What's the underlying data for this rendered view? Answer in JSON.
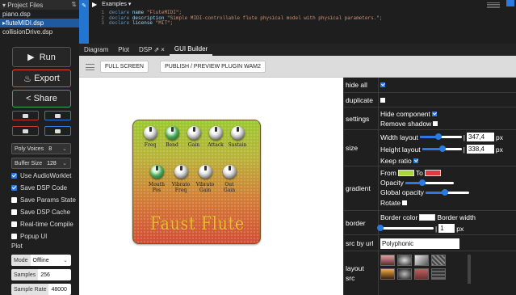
{
  "files": {
    "header": "Project Files",
    "items": [
      "piano.dsp",
      "fluteMIDI.dsp",
      "collisionDrive.dsp"
    ],
    "active": 1
  },
  "left": {
    "run": "Run",
    "export": "Export",
    "share": "Share",
    "poly": {
      "label": "Poly Voices",
      "value": "8"
    },
    "buffer": {
      "label": "Buffer Size",
      "value": "128"
    },
    "options": [
      {
        "label": "Use AudioWorklet",
        "checked": true
      },
      {
        "label": "Save DSP Code",
        "checked": true
      },
      {
        "label": "Save Params State",
        "checked": false
      },
      {
        "label": "Save DSP Cache",
        "checked": false
      },
      {
        "label": "Real-time Compile",
        "checked": false
      },
      {
        "label": "Popup UI",
        "checked": false
      }
    ],
    "plot_label": "Plot",
    "mode": {
      "label": "Mode",
      "value": "Offline"
    },
    "samples": {
      "label": "Samples",
      "value": "256"
    },
    "sample_rate": {
      "label": "Sample Rate",
      "value": "48000"
    }
  },
  "editor": {
    "examples": "Examples",
    "lines": [
      {
        "n": "1",
        "kw": "declare",
        "name": "name",
        "str": "\"FluteMIDI\";"
      },
      {
        "n": "2",
        "kw": "declare",
        "name": "description",
        "str": "\"Simple MIDI-controllable flute physical model with physical parameters.\";"
      },
      {
        "n": "3",
        "kw": "declare",
        "name": "license",
        "str": "\"MIT\";"
      }
    ]
  },
  "tabs": [
    "Diagram",
    "Plot",
    "DSP",
    "GUI Builder"
  ],
  "toolbar": {
    "fullscreen": "FULL SCREEN",
    "publish": "PUBLISH / PREVIEW PLUGIN WAM2"
  },
  "pedal": {
    "title": "Faust Flute",
    "row1": [
      "Freq",
      "Bend",
      "Gain",
      "Attack",
      "Sustain"
    ],
    "row2": [
      "Mouth Pos",
      "Vibrato Freq",
      "Vibrato Gain",
      "Out Gain"
    ]
  },
  "props": {
    "hide_all": "hide all",
    "duplicate": "duplicate",
    "settings": "settings",
    "hide_component": "Hide component",
    "remove_shadow": "Remove shadow",
    "size": "size",
    "width_layout": "Width layout",
    "width_value": "347,4",
    "height_layout": "Height layout",
    "height_value": "338,4",
    "px": "px",
    "keep_ratio": "Keep ratio",
    "gradient": "gradient",
    "from": "From",
    "to": "To",
    "opacity": "Opacity",
    "global_opacity": "Global opacity",
    "rotate": "Rotate",
    "from_color": "#a9d63a",
    "to_color": "#e23a3a",
    "width_fill": 0.45,
    "height_fill": 0.52,
    "opacity_fill": 0.35,
    "global_opacity_fill": 0.45,
    "border": "border",
    "border_color": "Border color",
    "border_width": "Border width",
    "border_width_value": "1",
    "src_by_url": "src by url",
    "src_value": "Polyphonic",
    "layout_src": "layout src"
  }
}
